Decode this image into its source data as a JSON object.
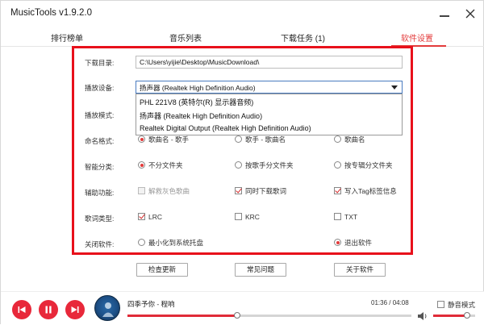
{
  "window": {
    "title": "MusicTools v1.9.2.0"
  },
  "tabs": [
    {
      "label": "排行榜单"
    },
    {
      "label": "音乐列表"
    },
    {
      "label": "下载任务 (1)"
    },
    {
      "label": "软件设置",
      "active": true
    }
  ],
  "settings": {
    "download_dir": {
      "label": "下载目录:",
      "value": "C:\\Users\\yijie\\Desktop\\MusicDownload\\"
    },
    "playback_device": {
      "label": "播放设备:",
      "selected": "扬声器 (Realtek High Definition Audio)",
      "options": [
        "PHL 221V8 (英特尔(R) 显示器音频)",
        "扬声器 (Realtek High Definition Audio)",
        "Realtek Digital Output (Realtek High Definition Audio)"
      ]
    },
    "playback_mode": {
      "label": "播放模式:"
    },
    "naming": {
      "label": "命名格式:",
      "options": [
        {
          "label": "歌曲名 - 歌手",
          "selected": true
        },
        {
          "label": "歌手 - 歌曲名",
          "selected": false
        },
        {
          "label": "歌曲名",
          "selected": false
        }
      ]
    },
    "smart_classify": {
      "label": "智能分类:",
      "options": [
        {
          "label": "不分文件夹",
          "selected": true
        },
        {
          "label": "按歌手分文件夹",
          "selected": false
        },
        {
          "label": "按专辑分文件夹",
          "selected": false
        }
      ]
    },
    "aux": {
      "label": "辅助功能:",
      "options": [
        {
          "label": "解救灰色歌曲",
          "checked": false,
          "disabled": true
        },
        {
          "label": "同时下载歌词",
          "checked": true
        },
        {
          "label": "写入Tag标签信息",
          "checked": true
        }
      ]
    },
    "lyrics_type": {
      "label": "歌词类型:",
      "options": [
        {
          "label": "LRC",
          "checked": true
        },
        {
          "label": "KRC",
          "checked": false
        },
        {
          "label": "TXT",
          "checked": false
        }
      ]
    },
    "close_behavior": {
      "label": "关闭软件:",
      "options": [
        {
          "label": "最小化到系统托盘",
          "selected": false
        },
        {
          "label": "退出软件",
          "selected": true
        }
      ]
    },
    "buttons": {
      "check_update": "检查更新",
      "faq": "常见问题",
      "about": "关于软件"
    }
  },
  "player": {
    "song": "四季予你 - 程响",
    "time": "01:36 / 04:08",
    "progress": 0.3871,
    "volume": 0.8,
    "mute_label": "静音模式",
    "mute": false
  },
  "colors": {
    "accent": "#e8283a",
    "highlight_border": "#e8101b"
  }
}
